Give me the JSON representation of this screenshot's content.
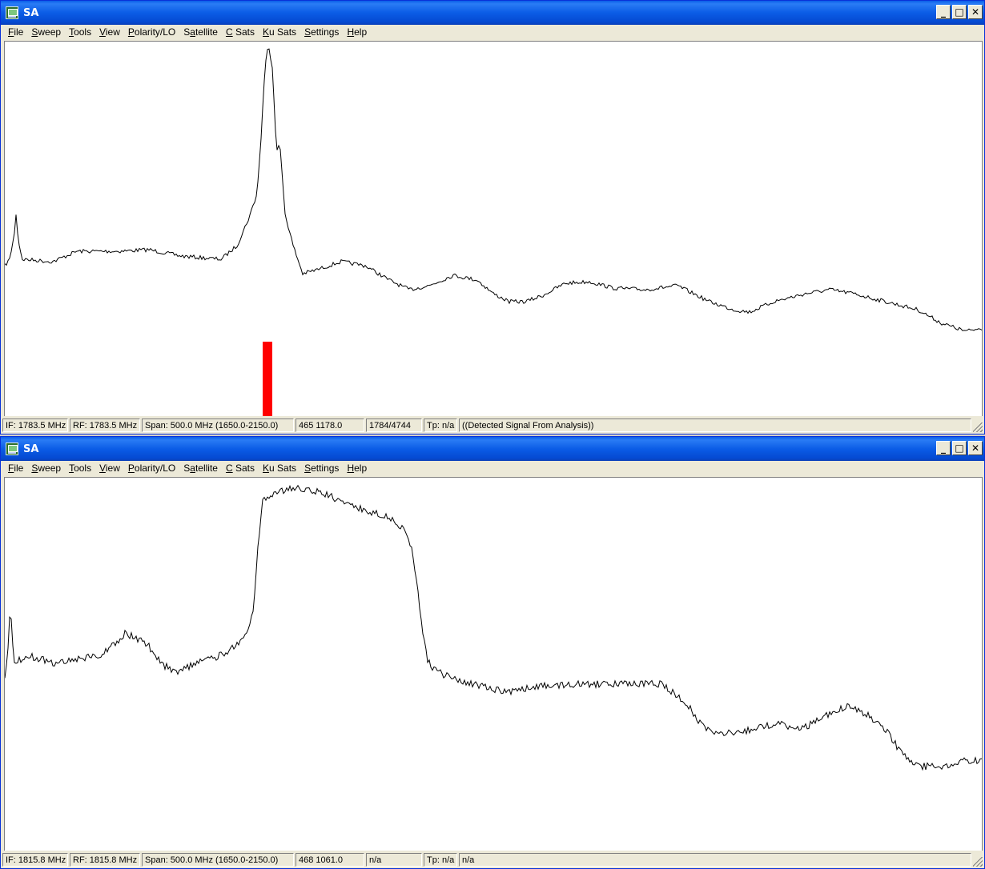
{
  "windows": [
    {
      "title": "SA",
      "menu": [
        "File",
        "Sweep",
        "Tools",
        "View",
        "Polarity/LO",
        "Satellite",
        "C Sats",
        "Ku Sats",
        "Settings",
        "Help"
      ],
      "status": {
        "if": "IF: 1783.5 MHz",
        "rf": "RF: 1783.5 MHz",
        "span": "Span: 500.0 MHz (1650.0-2150.0)",
        "cursor": "465 1178.0",
        "count": "1784/4744",
        "tp": "Tp: n/a",
        "note": "((Detected Signal From Analysis))"
      },
      "marker_color": "#ff0000"
    },
    {
      "title": "SA",
      "menu": [
        "File",
        "Sweep",
        "Tools",
        "View",
        "Polarity/LO",
        "Satellite",
        "C Sats",
        "Ku Sats",
        "Settings",
        "Help"
      ],
      "status": {
        "if": "IF: 1815.8 MHz",
        "rf": "RF: 1815.8 MHz",
        "span": "Span: 500.0 MHz (1650.0-2150.0)",
        "cursor": "468 1061.0",
        "count": "n/a",
        "tp": "Tp: n/a",
        "note": "n/a"
      }
    }
  ],
  "icons": {
    "app": "sa-app-icon",
    "minimize": "minimize-icon",
    "maximize": "maximize-icon",
    "close": "close-icon"
  },
  "glyphs": {
    "minimize": "_",
    "maximize": "□",
    "close": "✕"
  },
  "trace_color": "#000000"
}
